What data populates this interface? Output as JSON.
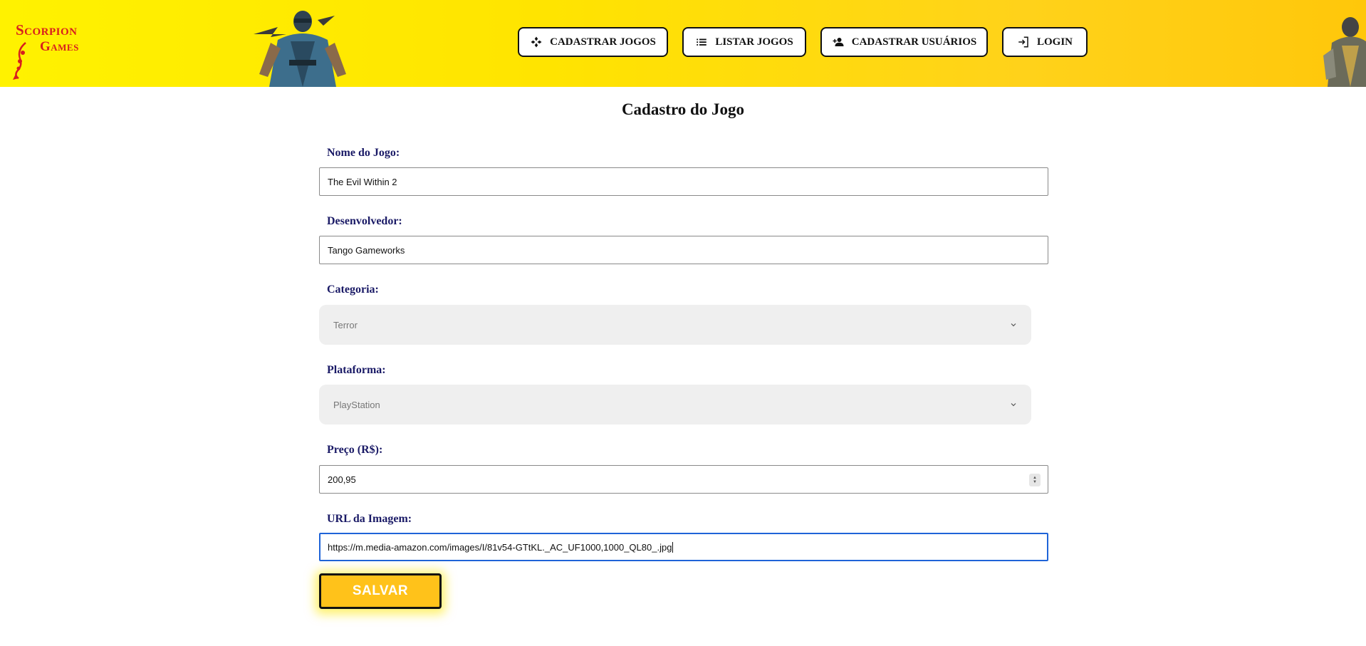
{
  "brand": {
    "logo_line1": "Scorpion",
    "logo_line2": "Games"
  },
  "nav": {
    "items": [
      {
        "label": "CADASTRAR JOGOS",
        "icon": "gamepad-icon"
      },
      {
        "label": "LISTAR JOGOS",
        "icon": "list-icon"
      },
      {
        "label": "CADASTRAR USUÁRIOS",
        "icon": "add-user-icon"
      },
      {
        "label": "LOGIN",
        "icon": "login-icon"
      }
    ]
  },
  "form": {
    "title": "Cadastro do Jogo",
    "name": {
      "label": "Nome do Jogo:",
      "value": "The Evil Within 2"
    },
    "developer": {
      "label": "Desenvolvedor:",
      "value": "Tango Gameworks"
    },
    "category": {
      "label": "Categoria:",
      "selected": "Terror"
    },
    "platform": {
      "label": "Plataforma:",
      "selected": "PlayStation"
    },
    "price": {
      "label": "Preço (R$):",
      "value": "200,95"
    },
    "image_url": {
      "label": "URL da Imagem:",
      "value": "https://m.media-amazon.com/images/I/81v54-GTtKL._AC_UF1000,1000_QL80_.jpg"
    },
    "save_label": "SALVAR"
  },
  "colors": {
    "header_start": "#fff200",
    "header_end": "#ffc70a",
    "brand_red": "#d81e1e",
    "label_navy": "#1a1a66",
    "save_button": "#ffc21a",
    "focus_blue": "#1f64d8"
  }
}
